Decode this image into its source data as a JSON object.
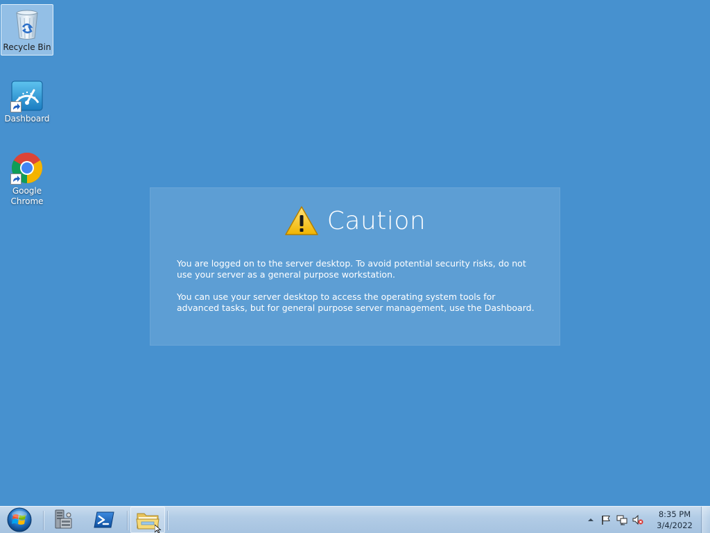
{
  "desktop": {
    "icons": [
      {
        "label": "Recycle Bin",
        "icon": "recycle-bin-icon",
        "selected": true
      },
      {
        "label": "Dashboard",
        "icon": "dashboard-icon",
        "selected": false
      },
      {
        "label": "Google Chrome",
        "icon": "chrome-icon",
        "selected": false
      }
    ]
  },
  "caution": {
    "title": "Caution",
    "icon": "warning-icon",
    "paragraph_1": "You are logged on to the server desktop. To avoid potential security risks, do not use your server as a general purpose workstation.",
    "paragraph_2": "You can use your server desktop to access the operating system tools for advanced tasks, but for general purpose server management, use the Dashboard."
  },
  "taskbar": {
    "buttons": [
      {
        "icon": "windows-logo-icon"
      },
      {
        "icon": "server-manager-icon"
      },
      {
        "icon": "powershell-icon"
      },
      {
        "icon": "folder-icon"
      }
    ],
    "tray_icons": [
      "chevron-up-icon",
      "action-center-flag-icon",
      "network-icon",
      "volume-muted-icon"
    ],
    "clock": {
      "time": "8:35 PM",
      "date": "3/4/2022"
    }
  },
  "colors": {
    "desktop_bg": "#4791cf",
    "taskbar_bg": "#b2cce6",
    "warning_yellow": "#f5c518"
  }
}
